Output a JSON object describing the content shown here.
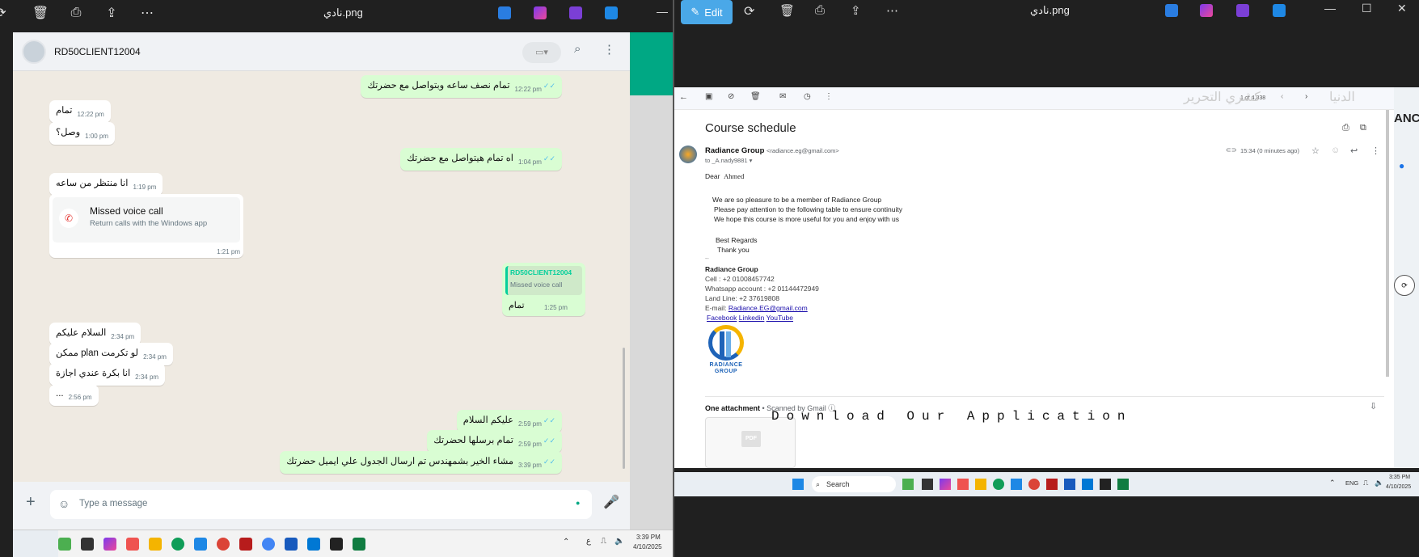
{
  "left_window": {
    "title": "نادي.png",
    "toolbar_icons": [
      "rotate-icon",
      "delete-icon",
      "print-icon",
      "share-icon",
      "more-icon"
    ],
    "app_icons": [
      "edit-app-icon",
      "copilot-icon",
      "clipchamp-icon",
      "onedrive-icon"
    ],
    "minimize": "—"
  },
  "whatsapp": {
    "contact_name": "RD50CLIENT12004",
    "messages": [
      {
        "dir": "out",
        "text": "تمام نصف ساعه وبتواصل مع حضرتك",
        "time": "12:22 pm"
      },
      {
        "dir": "in",
        "text": "تمام",
        "time": "12:22 pm"
      },
      {
        "dir": "in",
        "text": "وصل؟",
        "time": "1:00 pm"
      },
      {
        "dir": "out",
        "text": "اه تمام هيتواصل مع حضرتك",
        "time": "1:04 pm"
      },
      {
        "dir": "in",
        "text": "انا منتظر من ساعه",
        "time": "1:19 pm"
      },
      {
        "dir": "out",
        "text": "تمام",
        "time": "1:25 pm"
      },
      {
        "dir": "in",
        "text": "السلام عليكم",
        "time": "2:34 pm"
      },
      {
        "dir": "in",
        "text": "ممكن plan لو تكرمت",
        "time": "2:34 pm"
      },
      {
        "dir": "in",
        "text": "انا بكرة عندي اجازة",
        "time": "2:34 pm"
      },
      {
        "dir": "in",
        "text": "...",
        "time": "2:56 pm"
      },
      {
        "dir": "out",
        "text": "عليكم السلام",
        "time": "2:59 pm"
      },
      {
        "dir": "out",
        "text": "تمام برسلها لحضرتك",
        "time": "2:59 pm"
      },
      {
        "dir": "out",
        "text": "مشاء الخير بشمهندس تم ارسال الجدول علي ايميل حضرتك",
        "time": "3:39 pm"
      }
    ],
    "missed_call": {
      "title": "Missed voice call",
      "subtitle": "Return calls with the Windows app",
      "time": "1:21 pm"
    },
    "reply": {
      "name": "RD50CLIENT12004",
      "quoted": "Missed voice call"
    },
    "composer_placeholder": "Type a message",
    "taskbar_time": "3:39 PM",
    "taskbar_date": "4/10/2025",
    "taskbar_lang": "ع"
  },
  "right_window": {
    "edit_button": "Edit",
    "title": "نادي.png"
  },
  "gmail": {
    "page_counter": "1 of 4,838",
    "subject": "Course schedule",
    "sender_name": "Radiance Group",
    "sender_email": "<radiance.eg@gmail.com>",
    "to": "to _A.nady9881",
    "timestamp": "15:34 (0 minutes ago)",
    "greeting": "Dear",
    "greeting_name": "Ahmed",
    "body_lines": [
      "We are so pleasure to be a member of Radiance Group",
      "Please pay attention to the following table to ensure continuity",
      "We hope this course is more useful for you and enjoy with us"
    ],
    "regards": "Best Regards",
    "thanks": "Thank you",
    "dash": "--",
    "sig_company": "Radiance Group",
    "sig_cell": "Cell : +2 01008457742",
    "sig_whatsapp": "Whatsapp account : +2 01144472949",
    "sig_land": "Land Line: +2 37619808",
    "sig_email_label": "E-mail:",
    "sig_email": "Radiance.EG@gmail.com",
    "sig_links": [
      "Facebook",
      "Linkedin",
      "YouTube"
    ],
    "logo_text_1": "RADIANCE",
    "logo_text_2": "GROUP",
    "attach_title": "One attachment",
    "attach_scanned": "• Scanned by Gmail",
    "pdf_label": "PDF",
    "bg_banner": "Download Our Application",
    "bg_arabic_1": "كشري التحرير",
    "bg_arabic_2": "الدنيا",
    "map_badge": "ANC"
  },
  "right_taskbar": {
    "search": "Search",
    "lang": "ENG",
    "time": "3:35 PM",
    "date": "4/10/2025"
  }
}
